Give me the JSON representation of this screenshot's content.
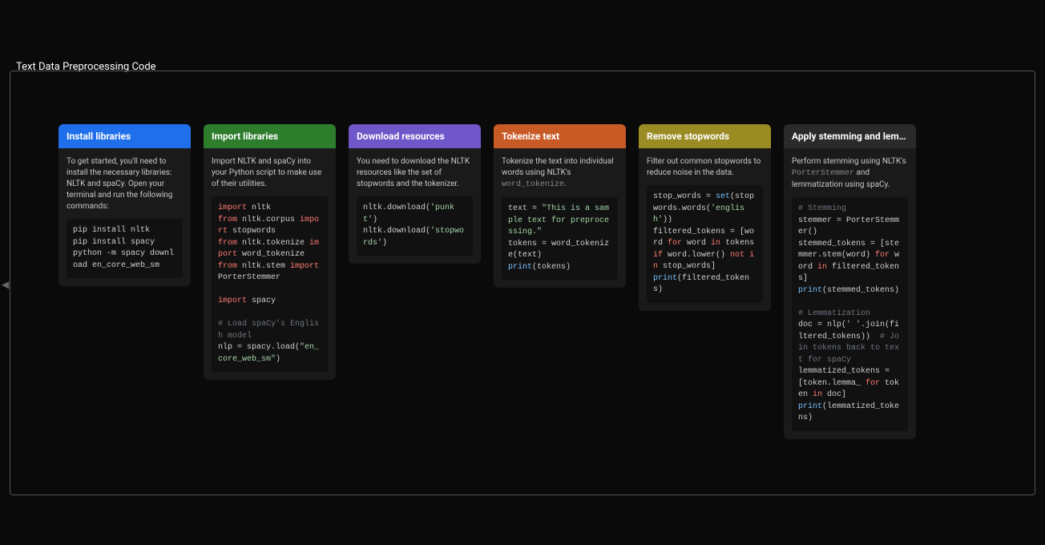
{
  "page_title": "Text Data Preprocessing Code",
  "cards": [
    {
      "id": "install",
      "header": "Install libraries",
      "color": "blue",
      "desc": "To get started, you'll need to install the necessary libraries: NLTK and spaCy. Open your terminal and run the following commands:",
      "code_plain": "pip install nltk\npip install spacy\npython -m spacy download en_core_web_sm"
    },
    {
      "id": "import",
      "header": "Import libraries",
      "color": "green",
      "desc": "Import NLTK and spaCy into your Python script to make use of their utilities."
    },
    {
      "id": "download",
      "header": "Download resources",
      "color": "purple",
      "desc": "You need to download the NLTK resources like the set of stopwords and the tokenizer."
    },
    {
      "id": "tokenize",
      "header": "Tokenize text",
      "color": "orange",
      "desc_prefix": "Tokenize the text into individual words using NLTK's ",
      "desc_code": "word_tokenize",
      "desc_suffix": "."
    },
    {
      "id": "stopwords",
      "header": "Remove stopwords",
      "color": "olive",
      "desc": "Filter out common stopwords to reduce noise in the data."
    },
    {
      "id": "stem",
      "header": "Apply stemming and lem…",
      "color": "dark",
      "desc_prefix": "Perform stemming using NLTK's ",
      "desc_code": "PorterStemmer",
      "desc_suffix": " and lemmatization using spaCy."
    }
  ]
}
